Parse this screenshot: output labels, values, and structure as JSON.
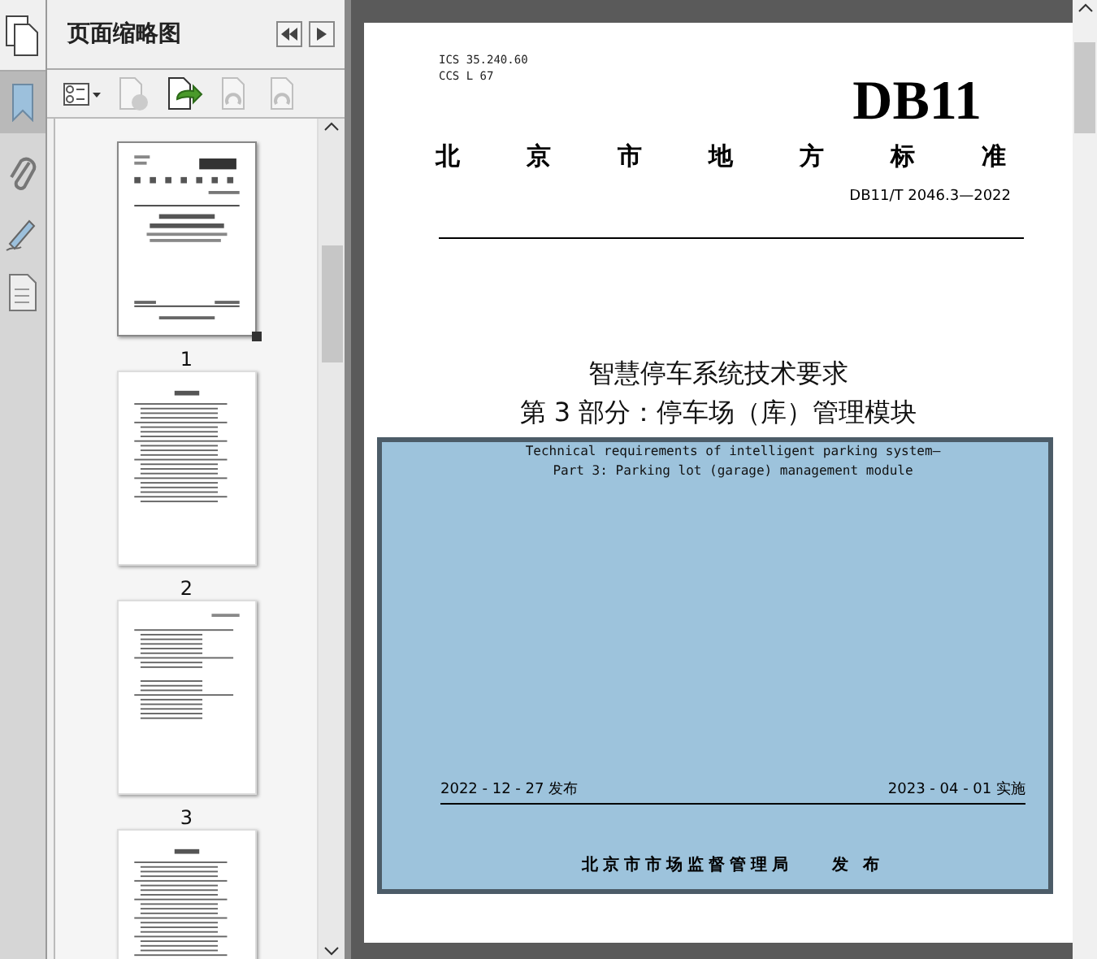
{
  "panel": {
    "title": "页面缩略图"
  },
  "thumbnails": [
    {
      "label": "1",
      "selected": true,
      "kind": "cover"
    },
    {
      "label": "2",
      "selected": false,
      "kind": "contents"
    },
    {
      "label": "3",
      "selected": false,
      "kind": "text"
    },
    {
      "selected": false,
      "kind": "contents"
    }
  ],
  "page": {
    "ics": "ICS  35.240.60",
    "ccs": "CCS  L 67",
    "logo": "DB11",
    "category": "北京市地方标准",
    "code": "DB11/T 2046.3—2022",
    "title_lines": [
      "智慧停车系统技术要求",
      "第 3 部分：停车场（库）管理模块"
    ],
    "english_lines": [
      "Technical requirements of intelligent parking system—",
      "Part 3: Parking lot (garage) management module"
    ],
    "issue_date": "2022 - 12 - 27 发布",
    "effective_date": "2023 - 04 - 01 实施",
    "publisher": "北京市市场监督管理局",
    "publish_word": "发 布"
  }
}
